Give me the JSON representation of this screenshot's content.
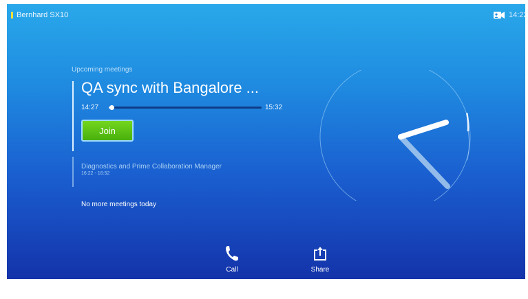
{
  "header": {
    "device_name": "Bernhard SX10",
    "time": "14:22",
    "status_color": "#f7e03a",
    "icons": [
      "status-indicator",
      "camera-icon"
    ]
  },
  "meetings": {
    "section_label": "Upcoming meetings",
    "current": {
      "title": "QA sync with Bangalore ...",
      "start": "14:27",
      "end": "15:32",
      "progress": 0.02,
      "join_label": "Join"
    },
    "next": {
      "title": "Diagnostics and Prime Collaboration Manager",
      "time": "16:22 - 16:52"
    },
    "no_more_label": "No more meetings today"
  },
  "actions": {
    "call_label": "Call",
    "share_label": "Share",
    "icons": [
      "phone-icon",
      "share-icon"
    ]
  },
  "clock": {
    "hour": 14,
    "minute": 22
  },
  "colors": {
    "join_green": "#5cc11a",
    "background_top": "#29a8ea",
    "background_bottom": "#1433aa"
  }
}
